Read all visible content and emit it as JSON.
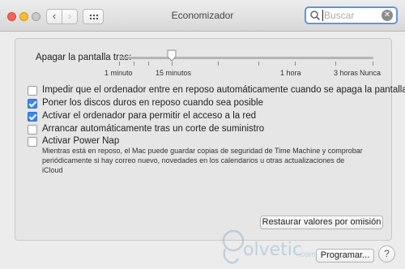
{
  "window": {
    "title": "Economizador"
  },
  "toolbar": {
    "back_glyph": "‹",
    "forward_glyph": "›",
    "grid_icon": "grid-icon"
  },
  "search": {
    "placeholder": "Buscar",
    "clear_glyph": "✕"
  },
  "slider": {
    "label": "Apagar la pantalla tras:",
    "ticks": [
      "1 minuto",
      "15 minutos",
      "1 hora",
      "3 horas",
      "Nunca"
    ],
    "value": "15 minutos"
  },
  "options": [
    {
      "label": "Impedir que el ordenador entre en reposo automáticamente cuando se apaga la pantalla",
      "checked": false
    },
    {
      "label": "Poner los discos duros en reposo cuando sea posible",
      "checked": true
    },
    {
      "label": "Activar el ordenador para permitir el acceso a la red",
      "checked": true
    },
    {
      "label": "Arrancar automáticamente tras un corte de suministro",
      "checked": false
    },
    {
      "label": "Activar Power Nap",
      "checked": false
    }
  ],
  "power_nap_desc": "Mientras está en reposo, el Mac puede guardar copias de seguridad de Time Machine y comprobar periódicamente si hay correo nuevo, novedades en los calendarios u otras actualizaciones de iCloud",
  "buttons": {
    "restore": "Restaurar valores por omisión",
    "schedule": "Programar...",
    "help": "?"
  },
  "watermark": {
    "text": "olvetic",
    "suffix": ".com"
  }
}
